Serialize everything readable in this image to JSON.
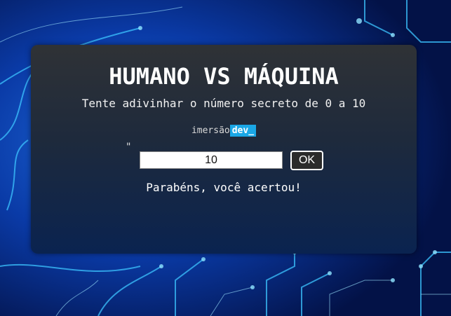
{
  "game": {
    "title": "HUMANO VS MÁQUINA",
    "subtitle": "Tente adivinhar o número secreto de 0 a 10",
    "brand_prefix": "imersão",
    "brand_highlight": "dev_",
    "stray_text": "\"",
    "guess_value": "10",
    "ok_label": "OK",
    "result_message": "Parabéns, você acertou!"
  },
  "colors": {
    "brand_highlight_bg": "#1aa7e6",
    "background_glow": "#2fa8ff"
  }
}
